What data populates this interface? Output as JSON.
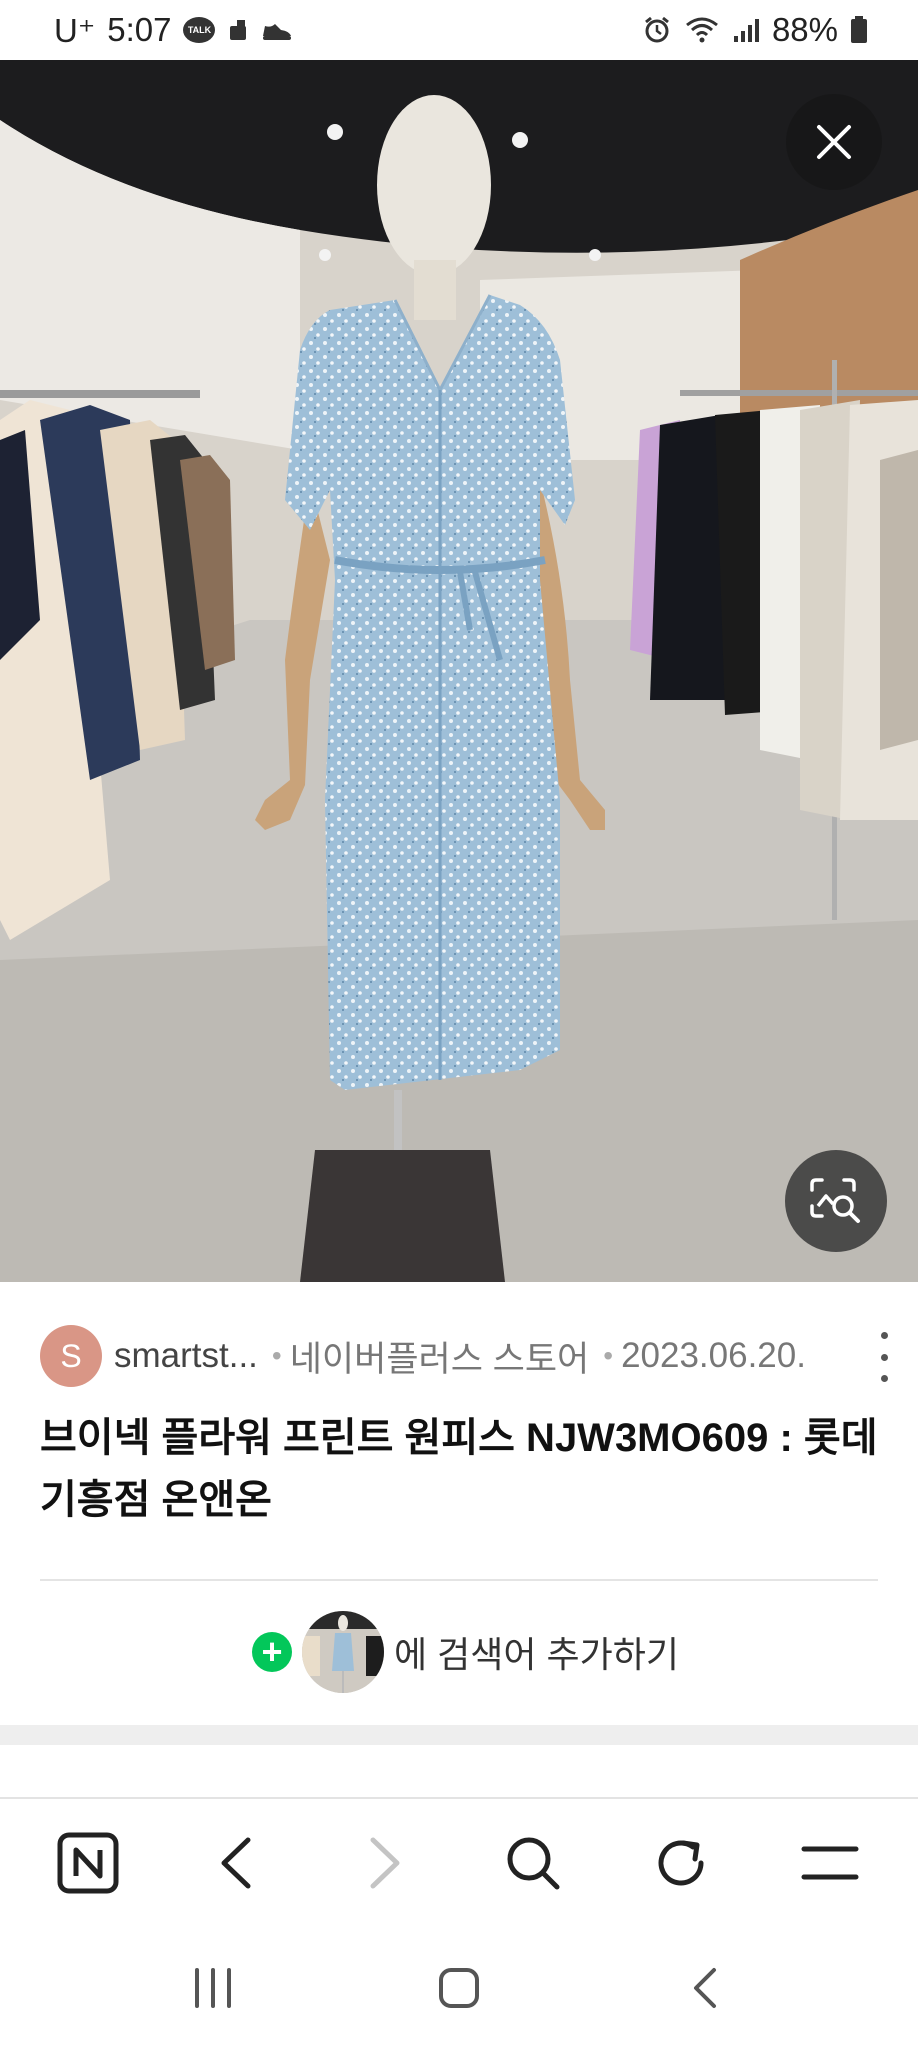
{
  "status_bar": {
    "carrier": "U⁺",
    "time": "5:07",
    "talk_badge": "TALK",
    "battery": "88%"
  },
  "viewer": {
    "image_alt": "Mannequin wearing light blue floral print wrap dress in clothing store",
    "close_icon": "close-icon",
    "lens_icon": "image-search-icon"
  },
  "result": {
    "avatar_letter": "S",
    "source": "smartst...",
    "store": "네이버플러스 스토어",
    "date": "2023.06.20.",
    "title": "브이넥 플라워 프린트 원피스 NJW3MO609 : 롯데 기흥점 온앤온",
    "add_search_text": "에 검색어 추가하기"
  },
  "toolbar": {
    "items": [
      "naver-home-icon",
      "back-icon",
      "forward-icon",
      "search-icon",
      "reload-icon",
      "menu-icon"
    ]
  },
  "navbar": {
    "items": [
      "recent-apps-icon",
      "home-icon",
      "back-icon"
    ]
  },
  "colors": {
    "accent_green": "#03c75a",
    "avatar_bg": "#d99686",
    "dress_blue": "#9ebfd8"
  }
}
